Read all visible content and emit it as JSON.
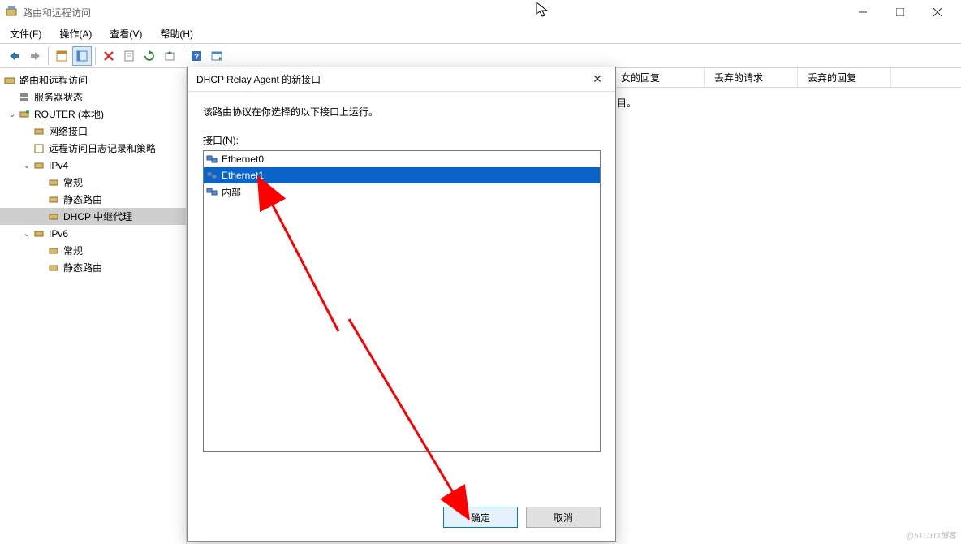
{
  "window": {
    "title": "路由和远程访问",
    "menus": {
      "file": "文件(F)",
      "action": "操作(A)",
      "view": "查看(V)",
      "help": "帮助(H)"
    }
  },
  "tree": {
    "root": "路由和远程访问",
    "server_status": "服务器状态",
    "router": "ROUTER (本地)",
    "net_if": "网络接口",
    "remote_log": "远程访问日志记录和策略",
    "ipv4": "IPv4",
    "ipv4_general": "常规",
    "ipv4_static": "静态路由",
    "ipv4_dhcp": "DHCP 中继代理",
    "ipv6": "IPv6",
    "ipv6_general": "常规",
    "ipv6_static": "静态路由"
  },
  "columns": {
    "reply": "女的回复",
    "drop_req": "丢弃的请求",
    "drop_reply": "丢弃的回复"
  },
  "hint": "目。",
  "dialog": {
    "title": "DHCP Relay Agent 的新接口",
    "desc": "该路由协议在你选择的以下接口上运行。",
    "if_label": "接口(N):",
    "interfaces": [
      {
        "name": "Ethernet0",
        "selected": false
      },
      {
        "name": "Ethernet1",
        "selected": true
      },
      {
        "name": "内部",
        "selected": false
      }
    ],
    "ok": "确定",
    "cancel": "取消"
  },
  "watermark": "@51CTO博客"
}
